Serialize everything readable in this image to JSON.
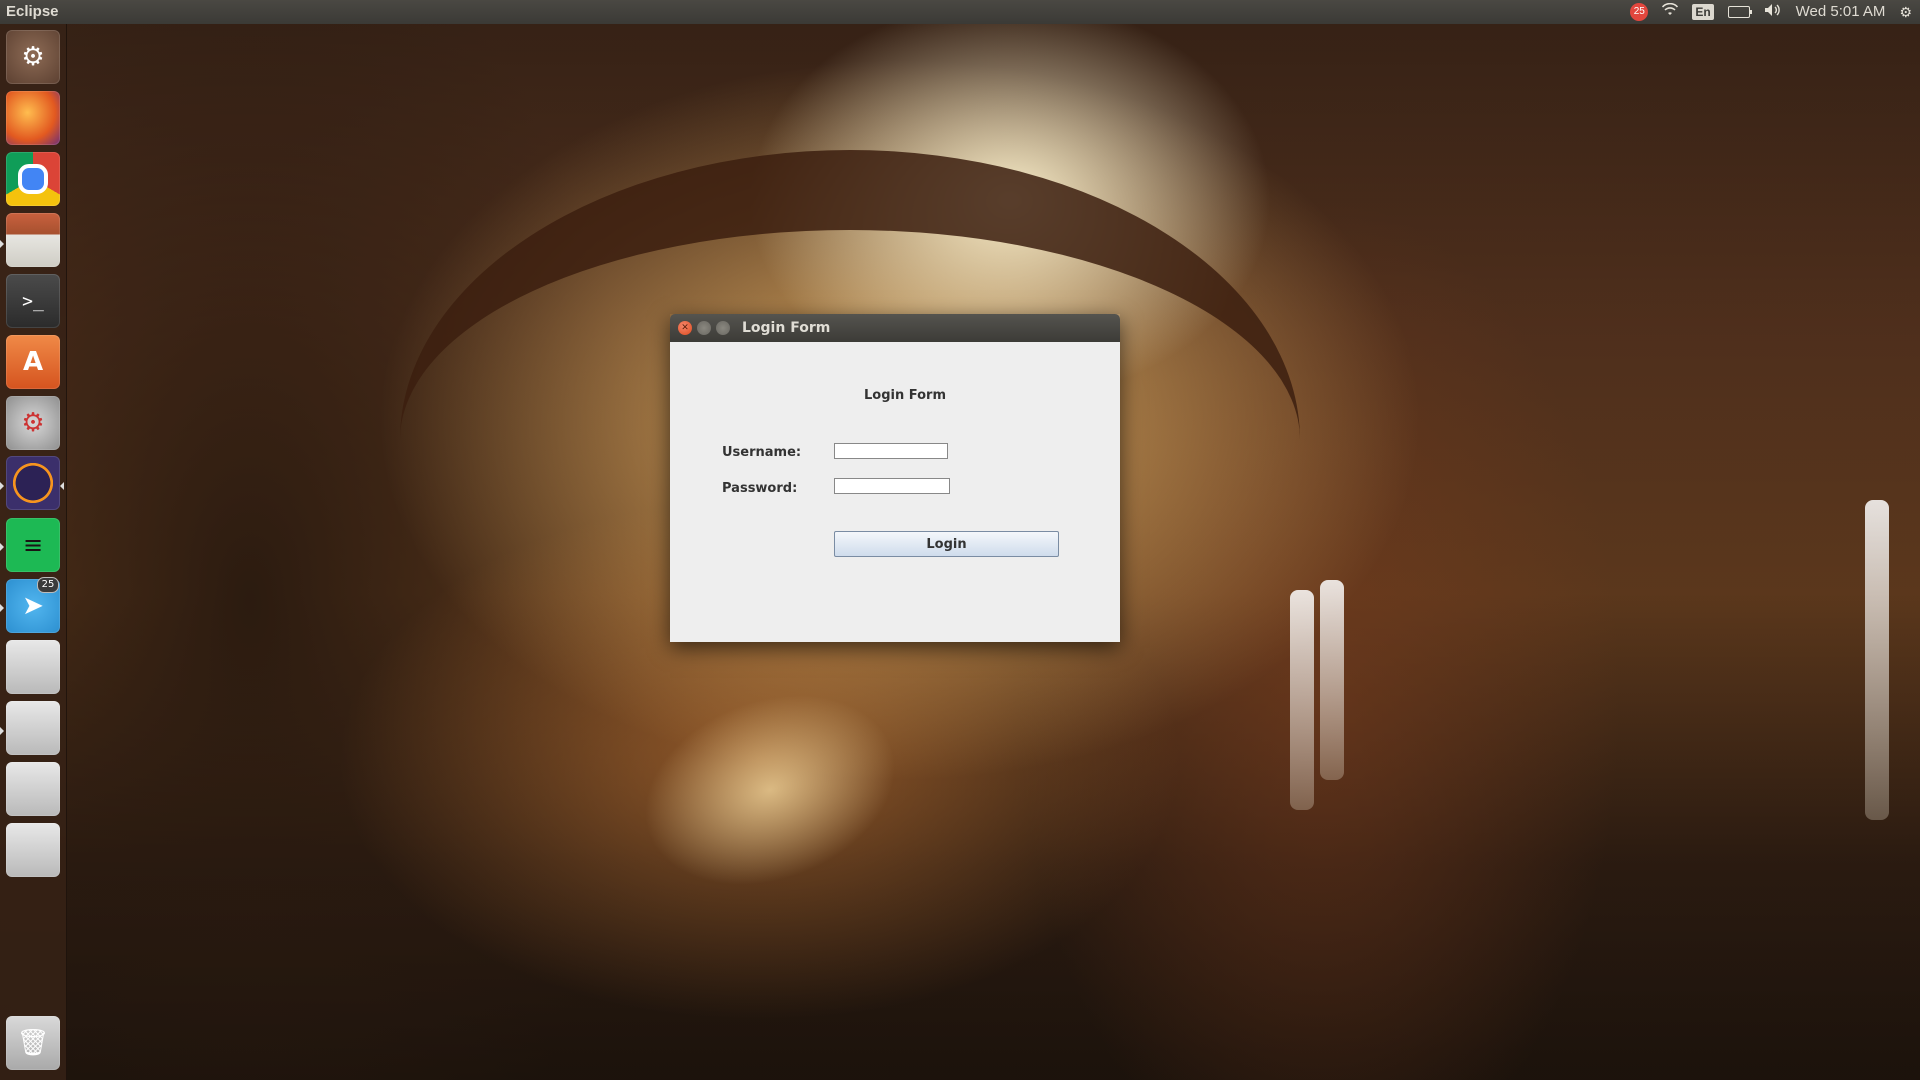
{
  "top_panel": {
    "app_title": "Eclipse",
    "notification_count": "25",
    "keyboard_layout": "En",
    "clock": "Wed 5:01 AM",
    "icons": [
      "notification-badge-icon",
      "wifi-icon",
      "keyboard-icon",
      "battery-icon",
      "volume-icon",
      "settings-gear-icon"
    ]
  },
  "launcher": {
    "items": [
      {
        "name": "dash-home",
        "icon": "ubuntu-logo-icon"
      },
      {
        "name": "firefox",
        "icon": "firefox-icon"
      },
      {
        "name": "chrome",
        "icon": "chrome-icon"
      },
      {
        "name": "files",
        "icon": "file-cabinet-icon"
      },
      {
        "name": "terminal",
        "icon": "terminal-icon"
      },
      {
        "name": "software-center",
        "icon": "software-store-icon"
      },
      {
        "name": "system-settings",
        "icon": "settings-icon"
      },
      {
        "name": "eclipse",
        "icon": "eclipse-icon"
      },
      {
        "name": "spotify",
        "icon": "spotify-icon"
      },
      {
        "name": "telegram",
        "icon": "telegram-icon",
        "badge": "25"
      },
      {
        "name": "drive-1",
        "icon": "hard-drive-icon"
      },
      {
        "name": "drive-2",
        "icon": "hard-drive-icon"
      },
      {
        "name": "drive-3",
        "icon": "hard-drive-icon"
      },
      {
        "name": "drive-4",
        "icon": "hard-drive-icon"
      },
      {
        "name": "trash",
        "icon": "trash-icon"
      }
    ]
  },
  "window": {
    "title": "Login Form",
    "controls": [
      "close",
      "minimize",
      "maximize"
    ],
    "heading": "Login Form",
    "username_label": "Username:",
    "username_value": "",
    "password_label": "Password:",
    "password_value": "",
    "login_button": "Login"
  },
  "colors": {
    "panel_bg": "#3c3b37",
    "dialog_bg": "#eeeeee",
    "close_button": "#de4b1f",
    "badge_red": "#e2473e"
  }
}
